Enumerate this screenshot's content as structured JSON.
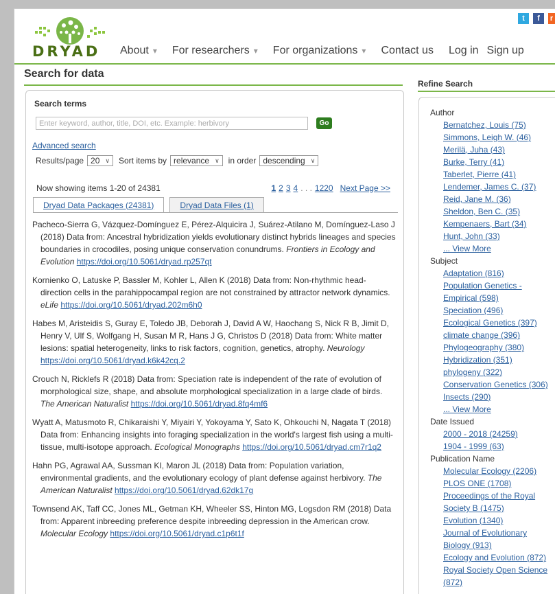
{
  "header": {
    "logo_text": "DRYAD",
    "nav": [
      {
        "label": "About",
        "dropdown": true
      },
      {
        "label": "For researchers",
        "dropdown": true
      },
      {
        "label": "For organizations",
        "dropdown": true
      }
    ],
    "contact": "Contact us",
    "login": "Log in",
    "signup": "Sign up",
    "social": {
      "twitter": "t",
      "facebook": "f",
      "rss": "r"
    }
  },
  "main": {
    "title": "Search for data",
    "search_terms_label": "Search terms",
    "search_placeholder": "Enter keyword, author, title, DOI, etc. Example: herbivory",
    "go_label": "Go",
    "advanced_search": "Advanced search",
    "results_per_page_label": "Results/page",
    "results_per_page_value": "20",
    "sort_by_label": "Sort items by",
    "sort_by_value": "relevance",
    "order_label": "in order",
    "order_value": "descending",
    "showing_text": "Now showing items 1-20 of 24381",
    "pagination": {
      "current": "1",
      "pages": [
        "2",
        "3",
        "4"
      ],
      "ellipsis": ". . .",
      "last": "1220",
      "next": "Next Page >>"
    },
    "tabs": [
      {
        "label": "Dryad Data Packages (24381)",
        "active": true
      },
      {
        "label": "Dryad Data Files (1)",
        "active": false
      }
    ],
    "results": [
      {
        "citation": "Pacheco-Sierra G, Vázquez-Domínguez E, Pérez-Alquicira J, Suárez-Atilano M, Domínguez-Laso J (2018) Data from: Ancestral hybridization yields evolutionary distinct hybrids lineages and species boundaries in crocodiles, posing unique conservation conundrums.",
        "journal": "Frontiers in Ecology and Evolution",
        "doi": "https://doi.org/10.5061/dryad.rp257qt"
      },
      {
        "citation": "Kornienko O, Latuske P, Bassler M, Kohler L, Allen K (2018) Data from: Non-rhythmic head-direction cells in the parahippocampal region are not constrained by attractor network dynamics.",
        "journal": "eLife",
        "doi": "https://doi.org/10.5061/dryad.202m6h0"
      },
      {
        "citation": "Habes M, Aristeidis S, Guray E, Toledo JB, Deborah J, David A W, Haochang S, Nick R B, Jimit D, Henry V, Ulf S, Wolfgang H, Susan M R, Hans J G, Christos D (2018) Data from: White matter lesions: spatial heterogeneity, links to risk factors, cognition, genetics, atrophy.",
        "journal": "Neurology",
        "doi": "https://doi.org/10.5061/dryad.k6k42cq.2"
      },
      {
        "citation": "Crouch N, Ricklefs R (2018) Data from: Speciation rate is independent of the rate of evolution of morphological size, shape, and absolute morphological specialization in a large clade of birds.",
        "journal": "The American Naturalist",
        "doi": "https://doi.org/10.5061/dryad.8fq4mf6"
      },
      {
        "citation": "Wyatt A, Matusmoto R, Chikaraishi Y, Miyairi Y, Yokoyama Y, Sato K, Ohkouchi N, Nagata T (2018) Data from: Enhancing insights into foraging specialization in the world's largest fish using a multi-tissue, multi-isotope approach.",
        "journal": "Ecological Monographs",
        "doi": "https://doi.org/10.5061/dryad.cm7r1q2"
      },
      {
        "citation": "Hahn PG, Agrawal AA, Sussman KI, Maron JL (2018) Data from: Population variation, environmental gradients, and the evolutionary ecology of plant defense against herbivory.",
        "journal": "The American Naturalist",
        "doi": "https://doi.org/10.5061/dryad.62dk17g"
      },
      {
        "citation": "Townsend AK, Taff CC, Jones ML, Getman KH, Wheeler SS, Hinton MG, Logsdon RM (2018) Data from: Apparent inbreeding preference despite inbreeding depression in the American crow.",
        "journal": "Molecular Ecology",
        "doi": "https://doi.org/10.5061/dryad.c1p6t1f"
      }
    ]
  },
  "sidebar": {
    "title": "Refine Search",
    "facets": [
      {
        "name": "Author",
        "items": [
          "Bernatchez, Louis (75)",
          "Simmons, Leigh W. (46)",
          "Merilä, Juha (43)",
          "Burke, Terry (41)",
          "Taberlet, Pierre (41)",
          "Lendemer, James C. (37)",
          "Reid, Jane M. (36)",
          "Sheldon, Ben C. (35)",
          "Kempenaers, Bart (34)",
          "Hunt, John (33)",
          "... View More"
        ]
      },
      {
        "name": "Subject",
        "items": [
          "Adaptation (816)",
          "Population Genetics -",
          "Empirical (598)",
          "Speciation (496)",
          "Ecological Genetics (397)",
          "climate change (396)",
          "Phylogeography (380)",
          "Hybridization (351)",
          "phylogeny (322)",
          "Conservation Genetics (306)",
          "Insects (290)",
          "... View More"
        ]
      },
      {
        "name": "Date Issued",
        "items": [
          "2000 - 2018 (24259)",
          "1904 - 1999 (63)"
        ]
      },
      {
        "name": "Publication Name",
        "items": [
          "Molecular Ecology (2206)",
          "PLOS ONE (1708)",
          "Proceedings of the Royal",
          "Society B (1475)",
          "Evolution (1340)",
          "Journal of Evolutionary",
          "Biology (913)",
          "Ecology and Evolution (872)",
          "Royal Society Open Science",
          "(872)"
        ]
      }
    ]
  },
  "colors": {
    "accent_green": "#7ab648",
    "go_button": "#2e7d1f",
    "link": "#2a5f9e"
  }
}
